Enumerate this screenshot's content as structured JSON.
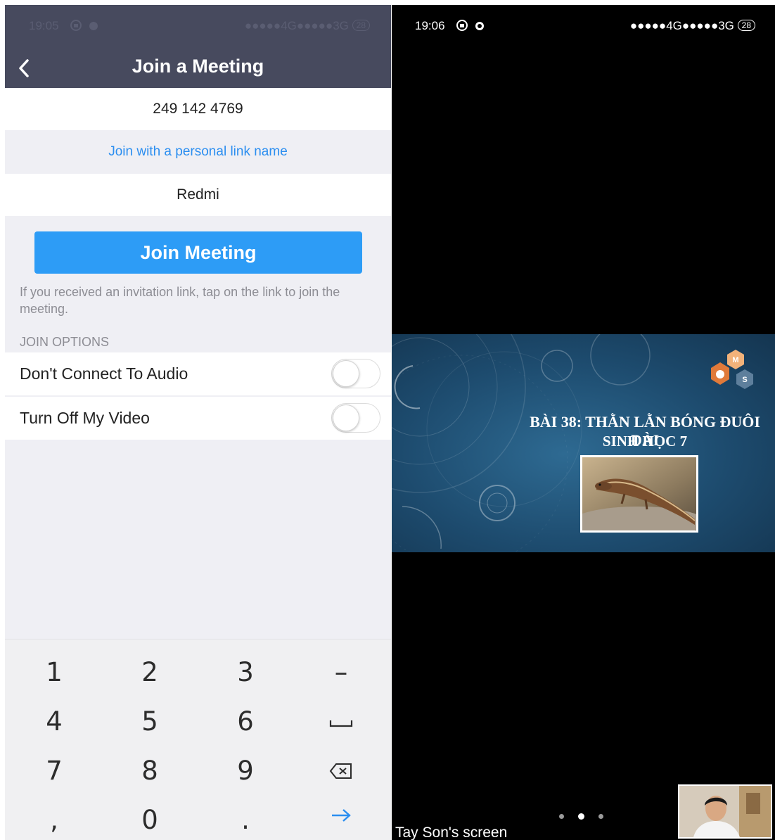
{
  "left_panel": {
    "status_bar": {
      "time": "19:05",
      "signal": "●●●●●4G●●●●●3G",
      "battery": "28"
    },
    "header": {
      "title": "Join a Meeting",
      "back_icon": "chevron-left-icon"
    },
    "meeting_id": "249 142 4769",
    "personal_link": "Join with a personal link name",
    "name_field": "Redmi",
    "join_button": "Join Meeting",
    "hint": "If you received an invitation link, tap on the link to join the meeting.",
    "join_options_label": "JOIN OPTIONS",
    "options": [
      {
        "label": "Don't Connect To Audio",
        "on": false
      },
      {
        "label": "Turn Off My Video",
        "on": false
      }
    ],
    "keypad": {
      "keys": [
        "1",
        "2",
        "3",
        "–",
        "4",
        "5",
        "6",
        "␣",
        "7",
        "8",
        "9",
        "⌫",
        ",",
        "0",
        ".",
        "→"
      ],
      "icons": {
        "space": "space-icon",
        "backspace": "backspace-icon",
        "enter": "arrow-right-icon"
      },
      "accent": "#2b8ef0"
    }
  },
  "right_panel": {
    "status_bar": {
      "time": "19:06",
      "signal": "●●●●●4G●●●●●3G",
      "battery": "28"
    },
    "slide": {
      "title": "BÀI 38: THẰN LẰN BÓNG ĐUÔI DÀI",
      "subtitle": "SINH HỌC 7",
      "logo_letters": [
        "M",
        "S"
      ]
    },
    "screen_label": "Tay Son's screen",
    "pager": {
      "count": 3,
      "active": 1
    }
  },
  "colors": {
    "header_bg": "#474a5e",
    "join_button": "#2d9cf6",
    "link": "#2b8ef0",
    "slide_bg": "#1d4b6e"
  }
}
